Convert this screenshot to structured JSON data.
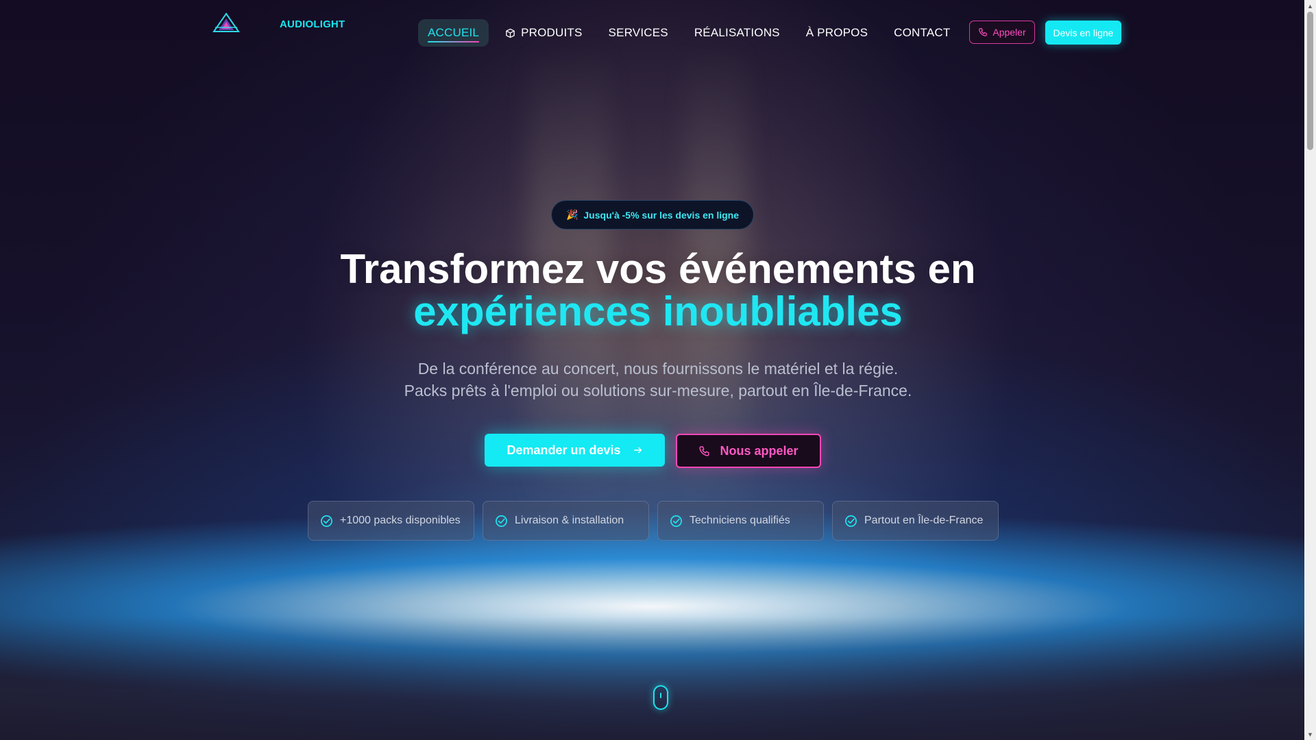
{
  "brand": {
    "name": "AUDIOLIGHT",
    "logo": "triangle-logo"
  },
  "nav": {
    "items": [
      {
        "label": "ACCUEIL",
        "active": true
      },
      {
        "label": "PRODUITS",
        "icon": "box-icon"
      },
      {
        "label": "SERVICES"
      },
      {
        "label": "RÉALISATIONS"
      },
      {
        "label": "À PROPOS"
      },
      {
        "label": "CONTACT"
      }
    ],
    "call_label": "Appeler",
    "quote_label": "Devis en ligne"
  },
  "hero": {
    "promo": "Jusqu'à -5% sur les devis en ligne",
    "promo_icon": "party-popper-icon",
    "title_line1": "Transformez vos événements en",
    "title_line2": "expériences inoubliables",
    "subtitle_line1": "De la conférence au concert, nous fournissons le matériel et la régie.",
    "subtitle_line2": "Packs prêts à l'emploi ou solutions sur-mesure, partout en Île-de-France.",
    "cta_quote": "Demander un devis",
    "cta_call": "Nous appeler",
    "features": [
      "+1000 packs disponibles",
      "Livraison & installation",
      "Techniciens qualifiés",
      "Partout en Île-de-France"
    ]
  },
  "colors": {
    "accent_cyan": "#13eaf4",
    "accent_pink": "#ff46b7",
    "background": "#110b1f"
  }
}
